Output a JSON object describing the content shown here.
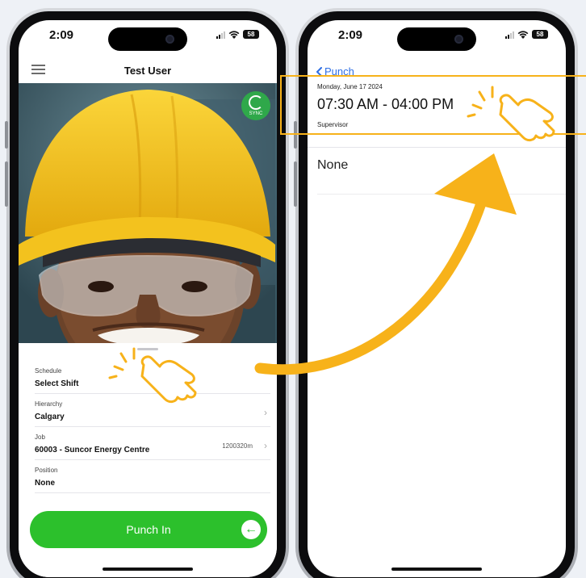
{
  "status_bar": {
    "time": "2:09",
    "battery": "58"
  },
  "left_screen": {
    "header_title": "Test User",
    "sync_label": "SYNC",
    "fields": [
      {
        "label": "Schedule",
        "value": "Select Shift",
        "meta": ""
      },
      {
        "label": "Hierarchy",
        "value": "Calgary",
        "meta": ""
      },
      {
        "label": "Job",
        "value": "60003 - Suncor Energy Centre",
        "meta": "1200320m"
      },
      {
        "label": "Position",
        "value": "None",
        "meta": ""
      }
    ],
    "punch_button": "Punch In"
  },
  "right_screen": {
    "back_label": "Punch",
    "shift": {
      "date": "Monday, June 17 2024",
      "time_range": "07:30 AM - 04:00 PM",
      "role": "Supervisor"
    },
    "option_none": "None"
  },
  "colors": {
    "accent_green": "#2cc02c",
    "ios_blue": "#2f6fe4",
    "annotation_orange": "#f7b21a",
    "hardhat_yellow": "#f5c218"
  },
  "icons": [
    "hamburger-icon",
    "sync-icon",
    "chevron-right-icon",
    "arrow-left-circle-icon",
    "back-chevron-icon",
    "tap-hand-icon"
  ]
}
